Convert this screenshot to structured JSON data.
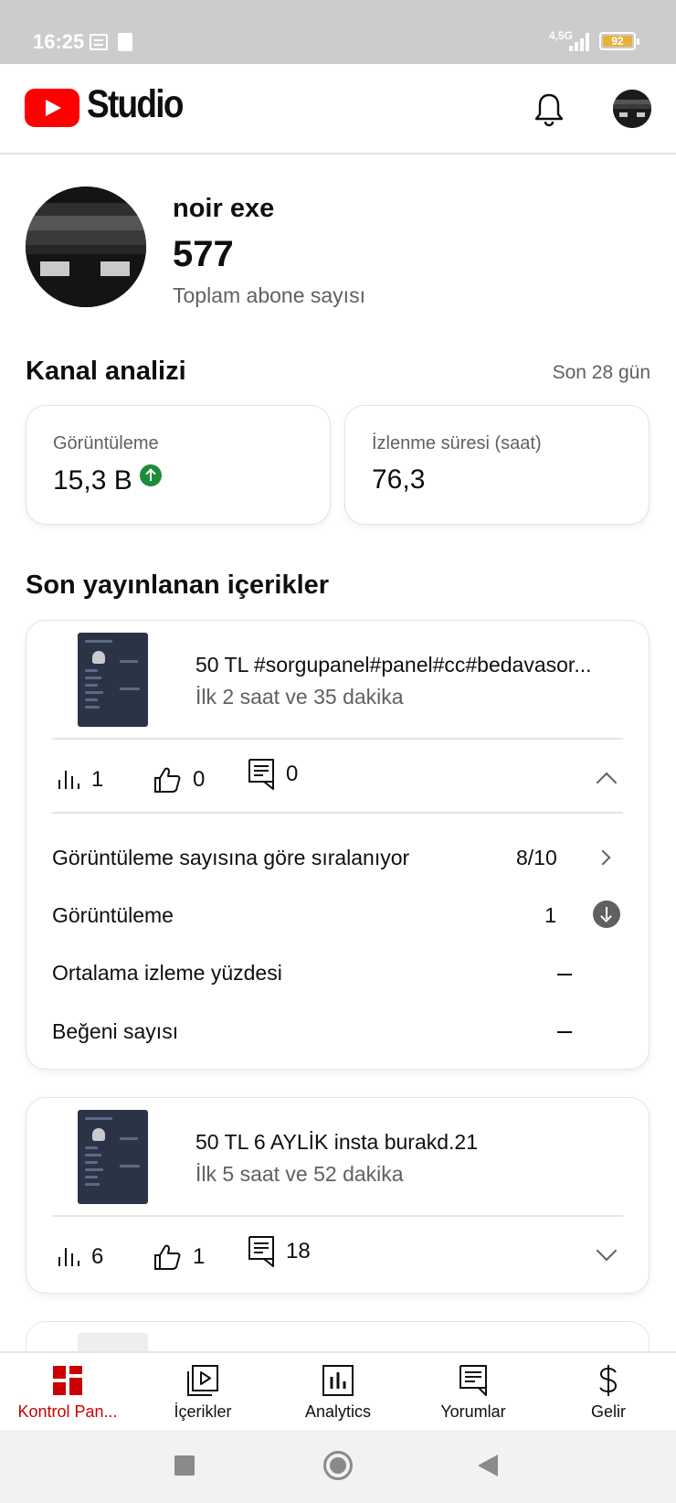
{
  "status_bar": {
    "time": "16:25",
    "network": "4,5G",
    "battery": "92"
  },
  "header": {
    "logo_text": "Studio"
  },
  "profile": {
    "channel_name": "noir exe",
    "subscriber_count": "577",
    "subscriber_label": "Toplam abone sayısı"
  },
  "analytics": {
    "title": "Kanal analizi",
    "period": "Son 28 gün",
    "views_label": "Görüntüleme",
    "views_value": "15,3 B",
    "watch_label": "İzlenme süresi (saat)",
    "watch_value": "76,3"
  },
  "recent": {
    "title": "Son yayınlanan içerikler",
    "videos": [
      {
        "title": "50 TL #sorgupanel#panel#cc#bedavasor...",
        "subtitle": "İlk 2 saat ve 35 dakika",
        "views": "1",
        "likes": "0",
        "comments": "0",
        "expanded": true,
        "details": {
          "ranking_label": "Görüntüleme sayısına göre sıralanıyor",
          "ranking_value": "8/10",
          "views_label": "Görüntüleme",
          "views_value": "1",
          "avg_label": "Ortalama izleme yüzdesi",
          "avg_value": "–",
          "likes_label": "Beğeni sayısı",
          "likes_value": "–"
        }
      },
      {
        "title": "50 TL 6 AYLİK insta burakd.21",
        "subtitle": "İlk 5 saat ve 52 dakika",
        "views": "6",
        "likes": "1",
        "comments": "18",
        "expanded": false
      }
    ]
  },
  "bottom_nav": {
    "items": [
      {
        "label": "Kontrol Pan...",
        "icon": "dashboard-icon",
        "active": true
      },
      {
        "label": "İçerikler",
        "icon": "content-icon",
        "active": false
      },
      {
        "label": "Analytics",
        "icon": "analytics-icon",
        "active": false
      },
      {
        "label": "Yorumlar",
        "icon": "comments-icon",
        "active": false
      },
      {
        "label": "Gelir",
        "icon": "dollar-icon",
        "active": false
      }
    ]
  },
  "colors": {
    "accent": "#cc0000",
    "youtube_red": "#ff0000",
    "positive": "#1e8b3a",
    "muted": "#606060"
  }
}
